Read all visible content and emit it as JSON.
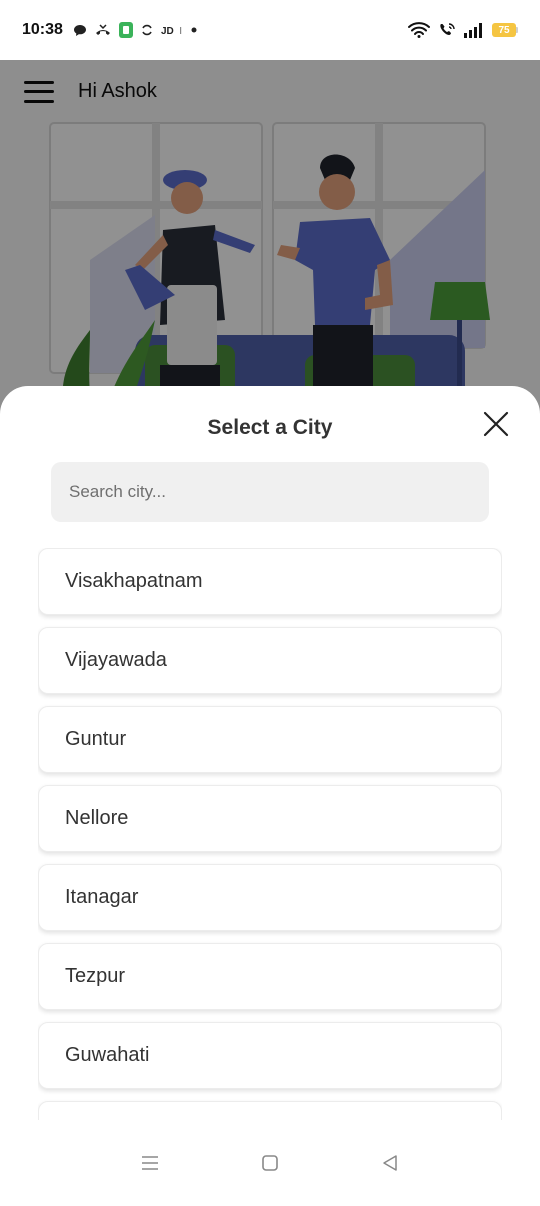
{
  "status_bar": {
    "time": "10:38",
    "battery": "75",
    "left_icons": [
      "chat-bubble-icon",
      "missed-call-icon",
      "app-badge-icon",
      "sync-icon",
      "jio-icon",
      "dot-icon"
    ],
    "right_icons": [
      "wifi-icon",
      "wifi-calling-icon",
      "signal-icon",
      "battery-icon"
    ]
  },
  "header": {
    "greeting": "Hi Ashok",
    "menu_icon": "hamburger-menu-icon"
  },
  "sheet": {
    "title": "Select a City",
    "close_icon": "close-icon",
    "search_placeholder": "Search city...",
    "cities": [
      "Visakhapatnam",
      "Vijayawada",
      "Guntur",
      "Nellore",
      "Itanagar",
      "Tezpur",
      "Guwahati",
      ""
    ]
  },
  "nav_bar": {
    "icons": [
      "recents-icon",
      "home-icon",
      "back-icon"
    ]
  },
  "colors": {
    "accent_blue": "#5b6bc9",
    "battery": "#f5c542",
    "overlay": "rgba(0,0,0,0.42)"
  }
}
